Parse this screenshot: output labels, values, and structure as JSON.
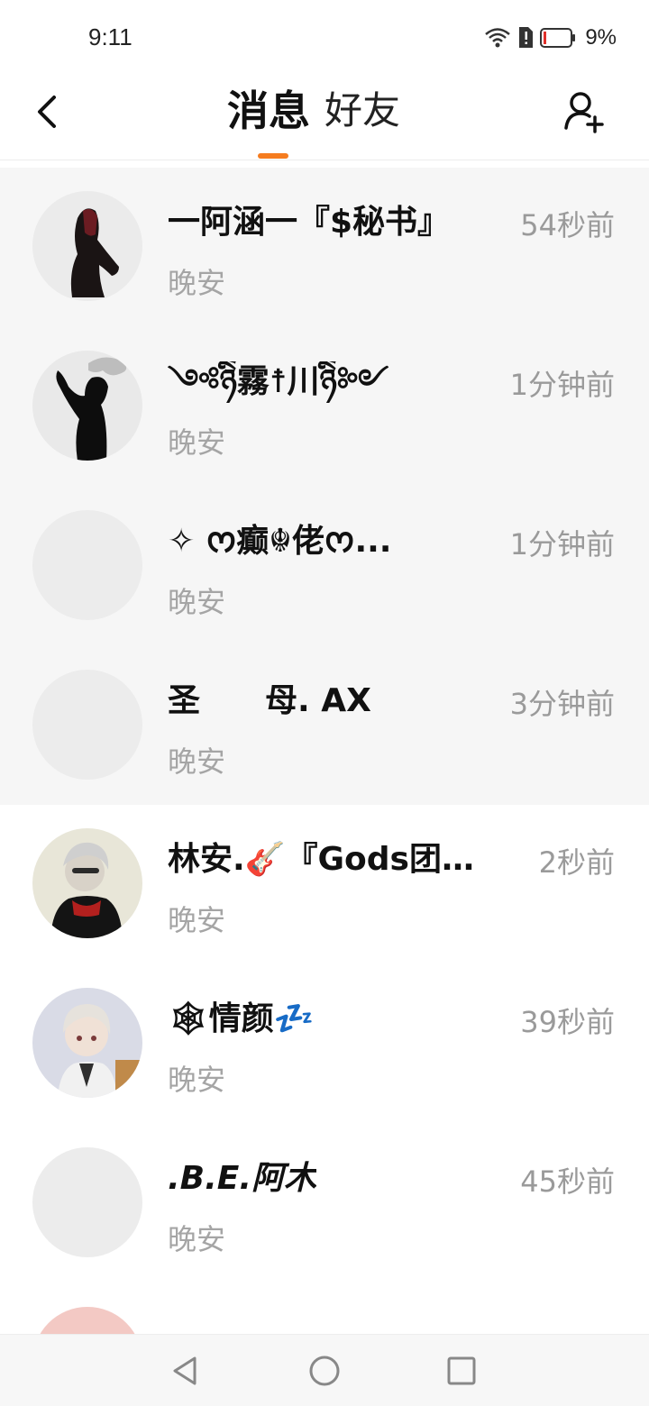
{
  "status_bar": {
    "time": "9:11",
    "battery": "9%"
  },
  "header": {
    "tabs": [
      {
        "label": "消息",
        "active": true
      },
      {
        "label": "好友",
        "active": false
      }
    ],
    "accent_color": "#f57c1f",
    "back_icon": "chevron-left-icon",
    "add_icon": "add-friend-icon"
  },
  "conversations": [
    {
      "name": "一阿涵一『$秘书』",
      "time": "54秒前",
      "preview": "晚安",
      "pinned": true,
      "avatar": "dark-figure"
    },
    {
      "name": "༺ཉིཻ霧☨川ཉིཻ༻",
      "time": "1分钟前",
      "preview": "晚安",
      "pinned": true,
      "avatar": "dark-figure-2"
    },
    {
      "name": "✧ ᰔ癫☬佬ᰔ...",
      "time": "1分钟前",
      "preview": "晚安",
      "pinned": true,
      "avatar": "blank"
    },
    {
      "name": "圣　　母. AX",
      "time": "3分钟前",
      "preview": "晚安",
      "pinned": true,
      "avatar": "blank"
    },
    {
      "name": "林安.🎸『Gods团长』",
      "time": "2秒前",
      "preview": "晚安",
      "pinned": false,
      "avatar": "character-1"
    },
    {
      "name": "🕸情颜💤",
      "time": "39秒前",
      "preview": "晚安",
      "pinned": false,
      "avatar": "character-2"
    },
    {
      "name": ".B.E.阿木",
      "time": "45秒前",
      "preview": "晚安",
      "pinned": false,
      "avatar": "blank"
    }
  ],
  "nav": {
    "back": "triangle-back-icon",
    "home": "circle-home-icon",
    "recents": "square-recents-icon"
  }
}
